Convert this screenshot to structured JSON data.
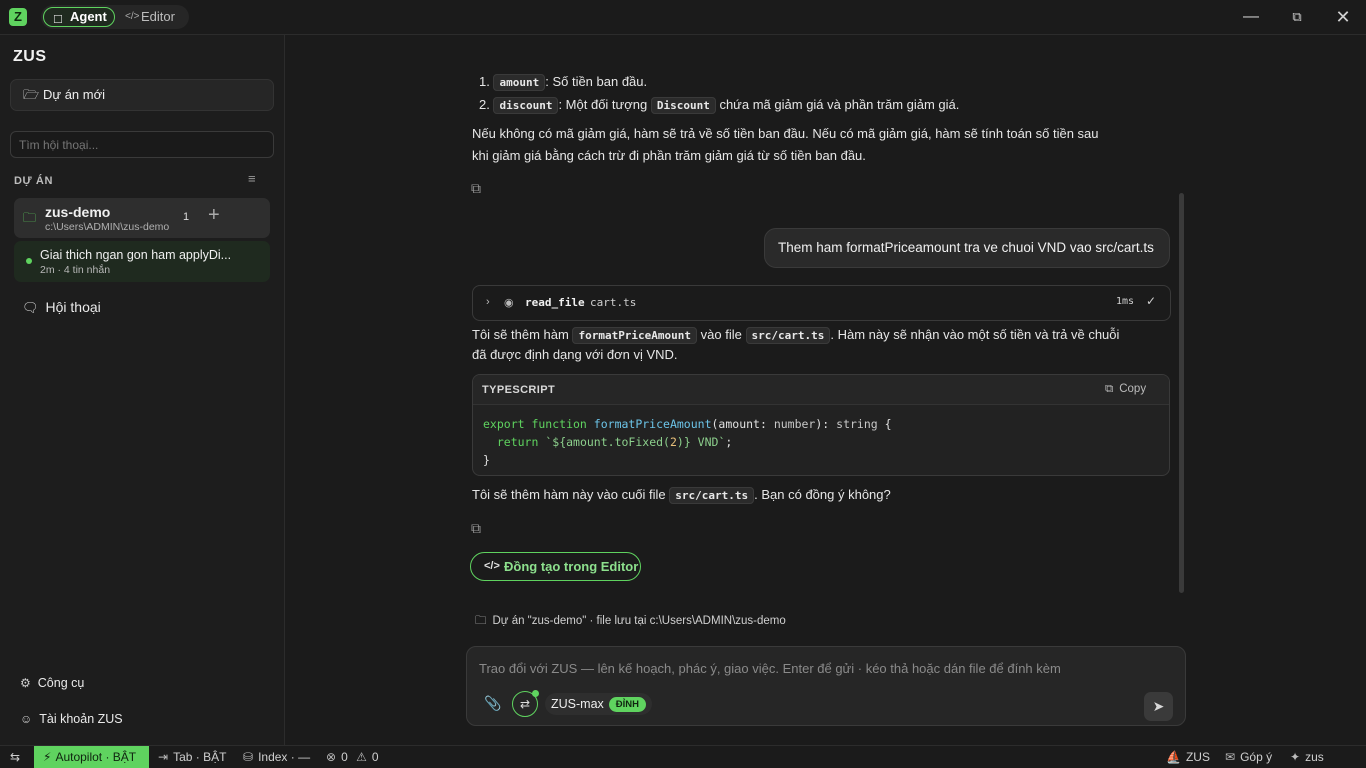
{
  "titlebar": {
    "logo": "Z",
    "modes": [
      {
        "label": "Agent",
        "icon": "chat-icon"
      },
      {
        "label": "Editor",
        "icon": "code-icon"
      }
    ],
    "window_controls": [
      "minimize",
      "restore",
      "close"
    ]
  },
  "sidebar": {
    "brand": "ZUS",
    "new_project": "Dự án mới",
    "search_placeholder": "Tìm hội thoại...",
    "section_label": "DỰ ÁN",
    "project": {
      "name": "zus-demo",
      "path": "c:\\Users\\ADMIN\\zus-demo",
      "count": "1"
    },
    "conversation": {
      "title": "Giai thich ngan gon ham applyDi...",
      "meta": "2m · 4 tin nhắn"
    },
    "conversations_link": "Hội thoại",
    "tools_link": "Công cụ",
    "account_link": "Tài khoản ZUS"
  },
  "chat": {
    "list_items": [
      {
        "num": "1.",
        "code": "amount",
        "text": ": Số tiền ban đầu."
      },
      {
        "num": "2.",
        "code": "discount",
        "text_before": ": Một đối tượng",
        "code2": "Discount",
        "text_after": "chứa mã giảm giá và phần trăm giảm giá."
      }
    ],
    "para1_line1": "Nếu không có mã giảm giá, hàm sẽ trả về số tiền ban đầu. Nếu có mã giảm giá, hàm sẽ tính toán số tiền sau",
    "para1_line2": "khi giảm giá bằng cách trừ đi phần trăm giảm giá từ số tiền ban đầu.",
    "user_message": "Them ham formatPriceamount tra ve chuoi VND vao src/cart.ts",
    "tool_call": {
      "name": "read_file",
      "arg": "cart.ts",
      "time": "1ms"
    },
    "para2": {
      "t1": "Tôi sẽ thêm hàm",
      "c1": "formatPriceAmount",
      "t2": "vào file",
      "c2": "src/cart.ts",
      "t3": ". Hàm này sẽ nhận vào một số tiền và trả về chuỗi",
      "line2": "đã được định dạng với đơn vị VND."
    },
    "code_block": {
      "language": "TYPESCRIPT",
      "copy_label": "Copy",
      "lines": [
        "export function formatPriceAmount(amount: number): string {",
        "  return `${amount.toFixed(2)} VND`;",
        "}"
      ]
    },
    "para3": {
      "t1": "Tôi sẽ thêm hàm này vào cuối file",
      "c1": "src/cart.ts",
      "t2": ". Bạn có đồng ý không?"
    },
    "cta_label": "Đồng tạo trong Editor",
    "project_info": "Dự án \"zus-demo\" · file lưu tại c:\\Users\\ADMIN\\zus-demo"
  },
  "composer": {
    "placeholder": "Trao đổi với ZUS — lên kế hoạch, phác ý, giao việc. Enter để gửi · kéo thả hoặc dán file để đính kèm",
    "model": "ZUS-max",
    "model_badge": "ĐỈNH"
  },
  "statusbar": {
    "autopilot": "Autopilot · BẬT",
    "tab": "Tab · BẬT",
    "index": "Index · —",
    "errors": "0",
    "warnings": "0",
    "right_zus": "ZUS",
    "feedback": "Góp ý",
    "right_zus2": "zus"
  },
  "colors": {
    "accent": "#5fd35f",
    "background": "#1b1b1b",
    "panel": "#262626"
  }
}
